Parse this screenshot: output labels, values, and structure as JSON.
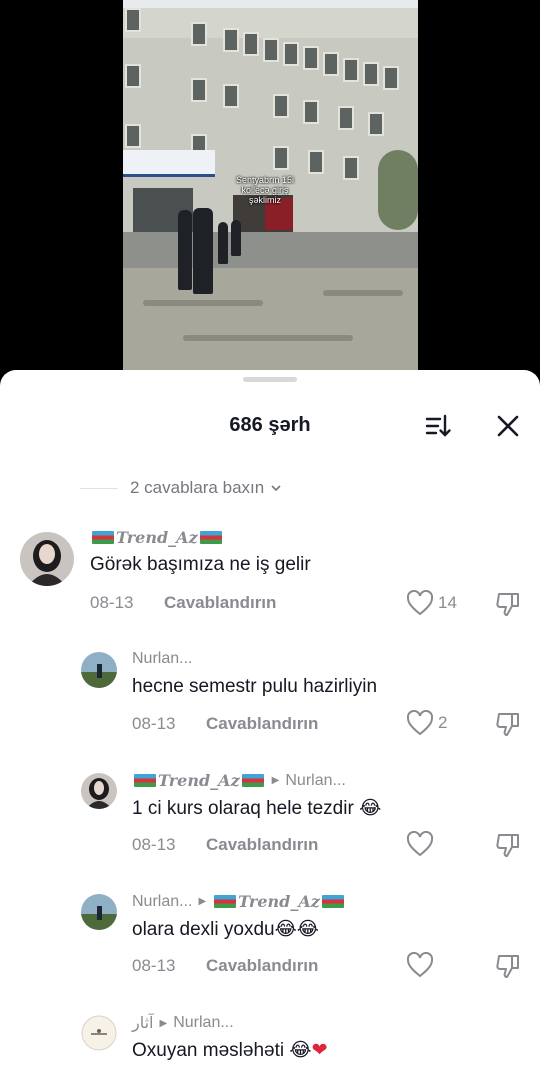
{
  "video": {
    "caption": "Sentyabrın 15i kollecə giriş şəklimiz"
  },
  "sheet": {
    "title": "686 şərh",
    "more_replies": "2 cavablara baxın"
  },
  "comments": [
    {
      "user": "Trend_Az",
      "reply_to": "",
      "text": "Görək başımıza ne iş gelir",
      "date": "08-13",
      "reply_label": "Cavablandırın",
      "likes": "14"
    },
    {
      "user": "Nurlan...",
      "reply_to": "",
      "text": "hecne semestr pulu hazirliyin",
      "date": "08-13",
      "reply_label": "Cavablandırın",
      "likes": "2"
    },
    {
      "user": "Trend_Az",
      "reply_to": "Nurlan...",
      "text": "1 ci kurs olaraq hele tezdir",
      "emoji": "😂",
      "date": "08-13",
      "reply_label": "Cavablandırın",
      "likes": ""
    },
    {
      "user": "Nurlan...",
      "reply_to": "Trend_Az",
      "text": "olara dexli yoxdu",
      "emoji": "😂😂",
      "date": "08-13",
      "reply_label": "Cavablandırın",
      "likes": ""
    },
    {
      "user": "آثار",
      "reply_to": "Nurlan...",
      "text": "Oxuyan məsləhəti ",
      "emoji": "😂",
      "emoji2": "❤",
      "date": "",
      "reply_label": "",
      "likes": ""
    }
  ]
}
